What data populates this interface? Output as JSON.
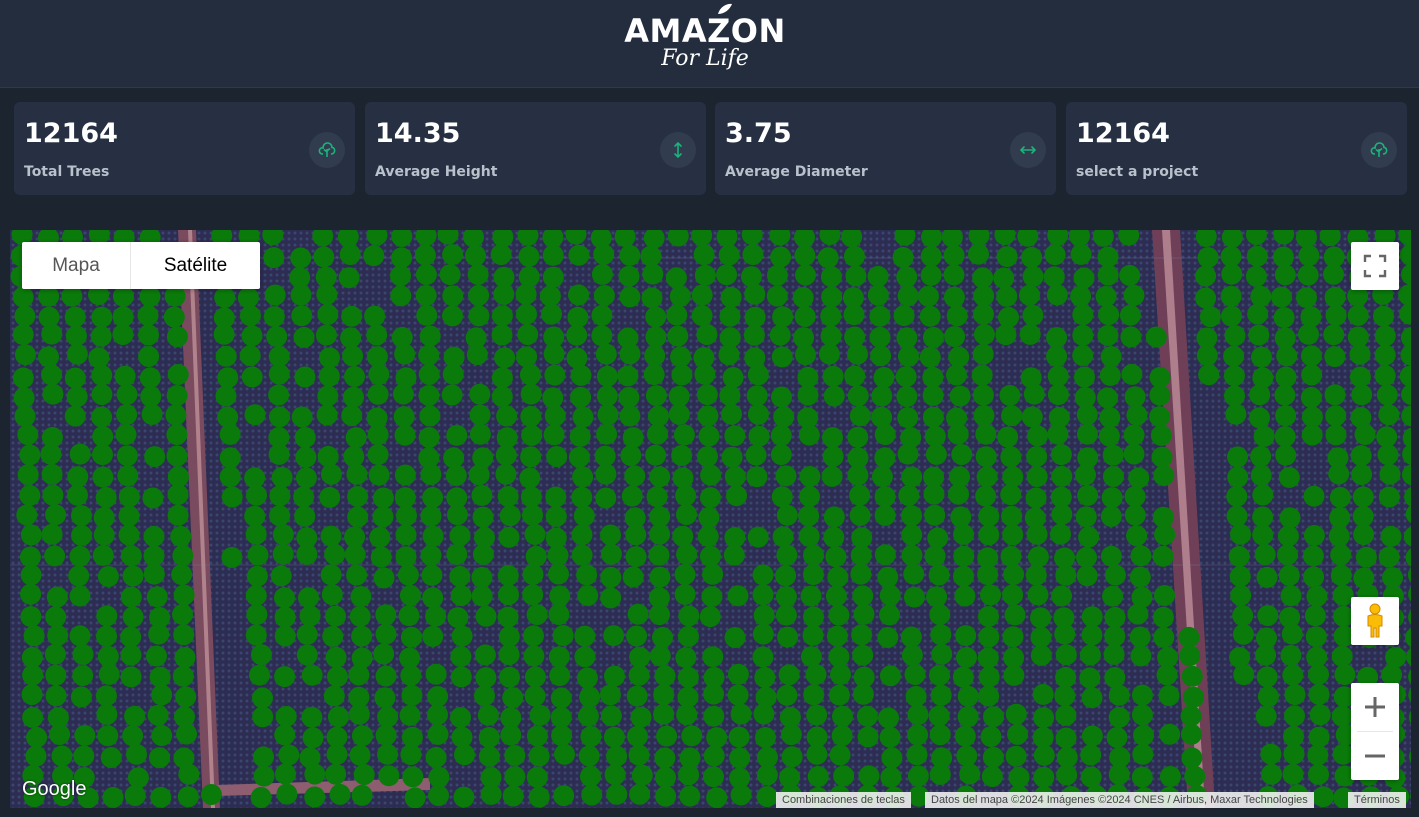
{
  "header": {
    "logo_top": "AMAZON",
    "logo_bottom": "For Life"
  },
  "stats": [
    {
      "value": "12164",
      "label": "Total Trees",
      "icon": "tree-icon"
    },
    {
      "value": "14.35",
      "label": "Average Height",
      "icon": "vertical-arrows-icon"
    },
    {
      "value": "3.75",
      "label": "Average Diameter",
      "icon": "horizontal-arrows-icon"
    },
    {
      "value": "12164",
      "label": "select a project",
      "icon": "tree-icon"
    }
  ],
  "map": {
    "map_type_buttons": [
      "Mapa",
      "Satélite"
    ],
    "selected_map_type": "Satélite",
    "google_logo": "Google",
    "attribution": {
      "shortcuts": "Combinaciones de teclas",
      "data": "Datos del mapa ©2024 Imágenes ©2024 CNES / Airbus, Maxar Technologies",
      "terms": "Términos"
    },
    "tree_marker_color": "#0a7a0a"
  },
  "colors": {
    "page_bg": "#1c2430",
    "card_bg": "#263042",
    "accent": "#19b57a"
  }
}
